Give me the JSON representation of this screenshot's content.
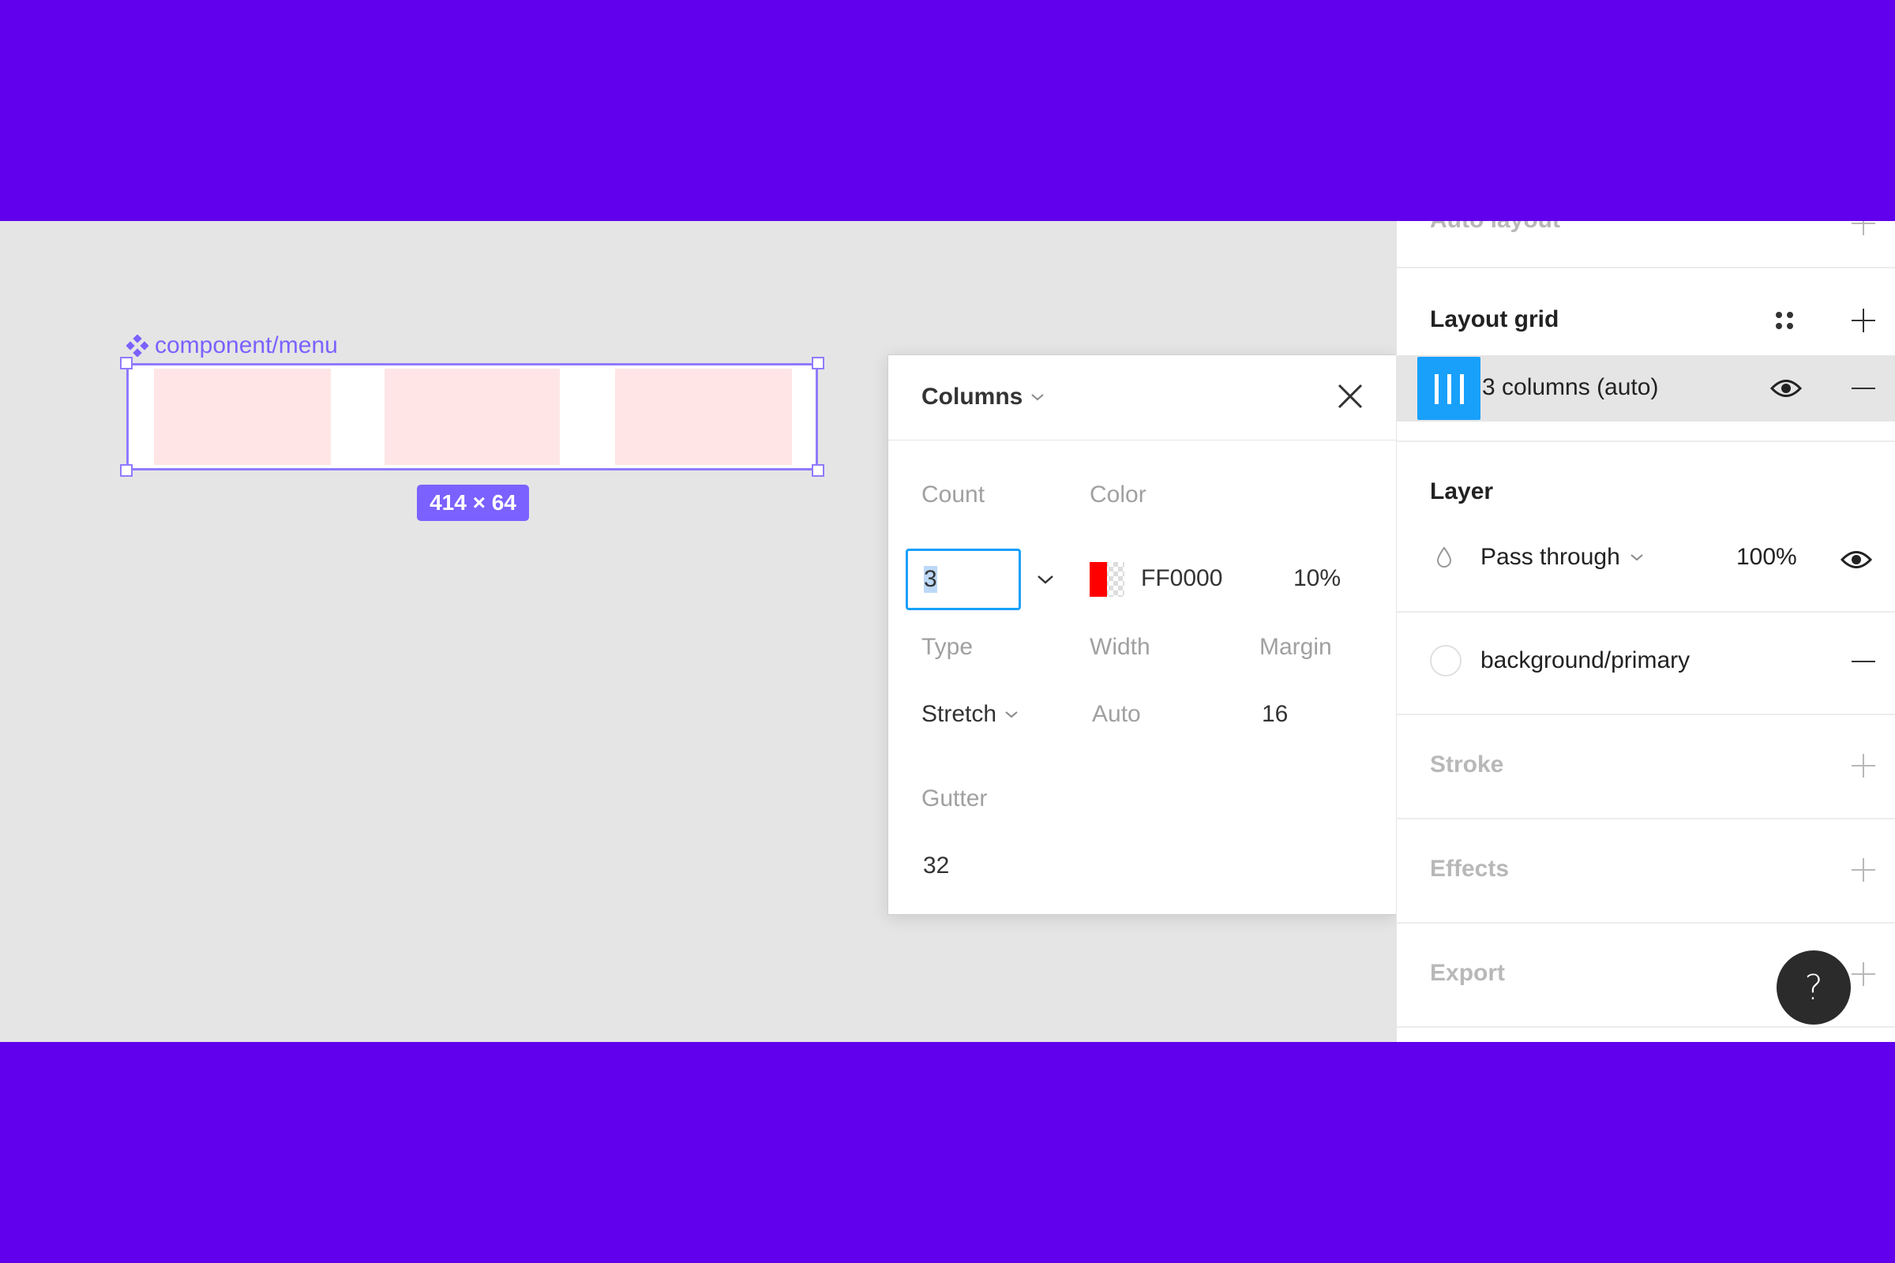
{
  "colors": {
    "brand": "#6000EC",
    "accent": "#7B61FF",
    "selection_blue": "#18A0FB",
    "grid_fill": "#FFE5E5",
    "grid_color": "#FF0000"
  },
  "canvas": {
    "frame_label": "component/menu",
    "size_badge": "414 × 64",
    "component_icon": "component-icon"
  },
  "popover": {
    "title": "Columns",
    "count_label": "Count",
    "count_value": "3",
    "color_label": "Color",
    "color_hex": "FF0000",
    "color_opacity": "10%",
    "type_label": "Type",
    "type_value": "Stretch",
    "width_label": "Width",
    "width_value": "Auto",
    "margin_label": "Margin",
    "margin_value": "16",
    "gutter_label": "Gutter",
    "gutter_value": "32"
  },
  "sidebar": {
    "auto_layout_title": "Auto layout",
    "layout_grid_title": "Layout grid",
    "grid_item_label": "3 columns (auto)",
    "layer_title": "Layer",
    "blend_mode": "Pass through",
    "layer_opacity": "100%",
    "fill_name": "background/primary",
    "stroke_title": "Stroke",
    "effects_title": "Effects",
    "export_title": "Export"
  },
  "help": {
    "label": "?"
  }
}
